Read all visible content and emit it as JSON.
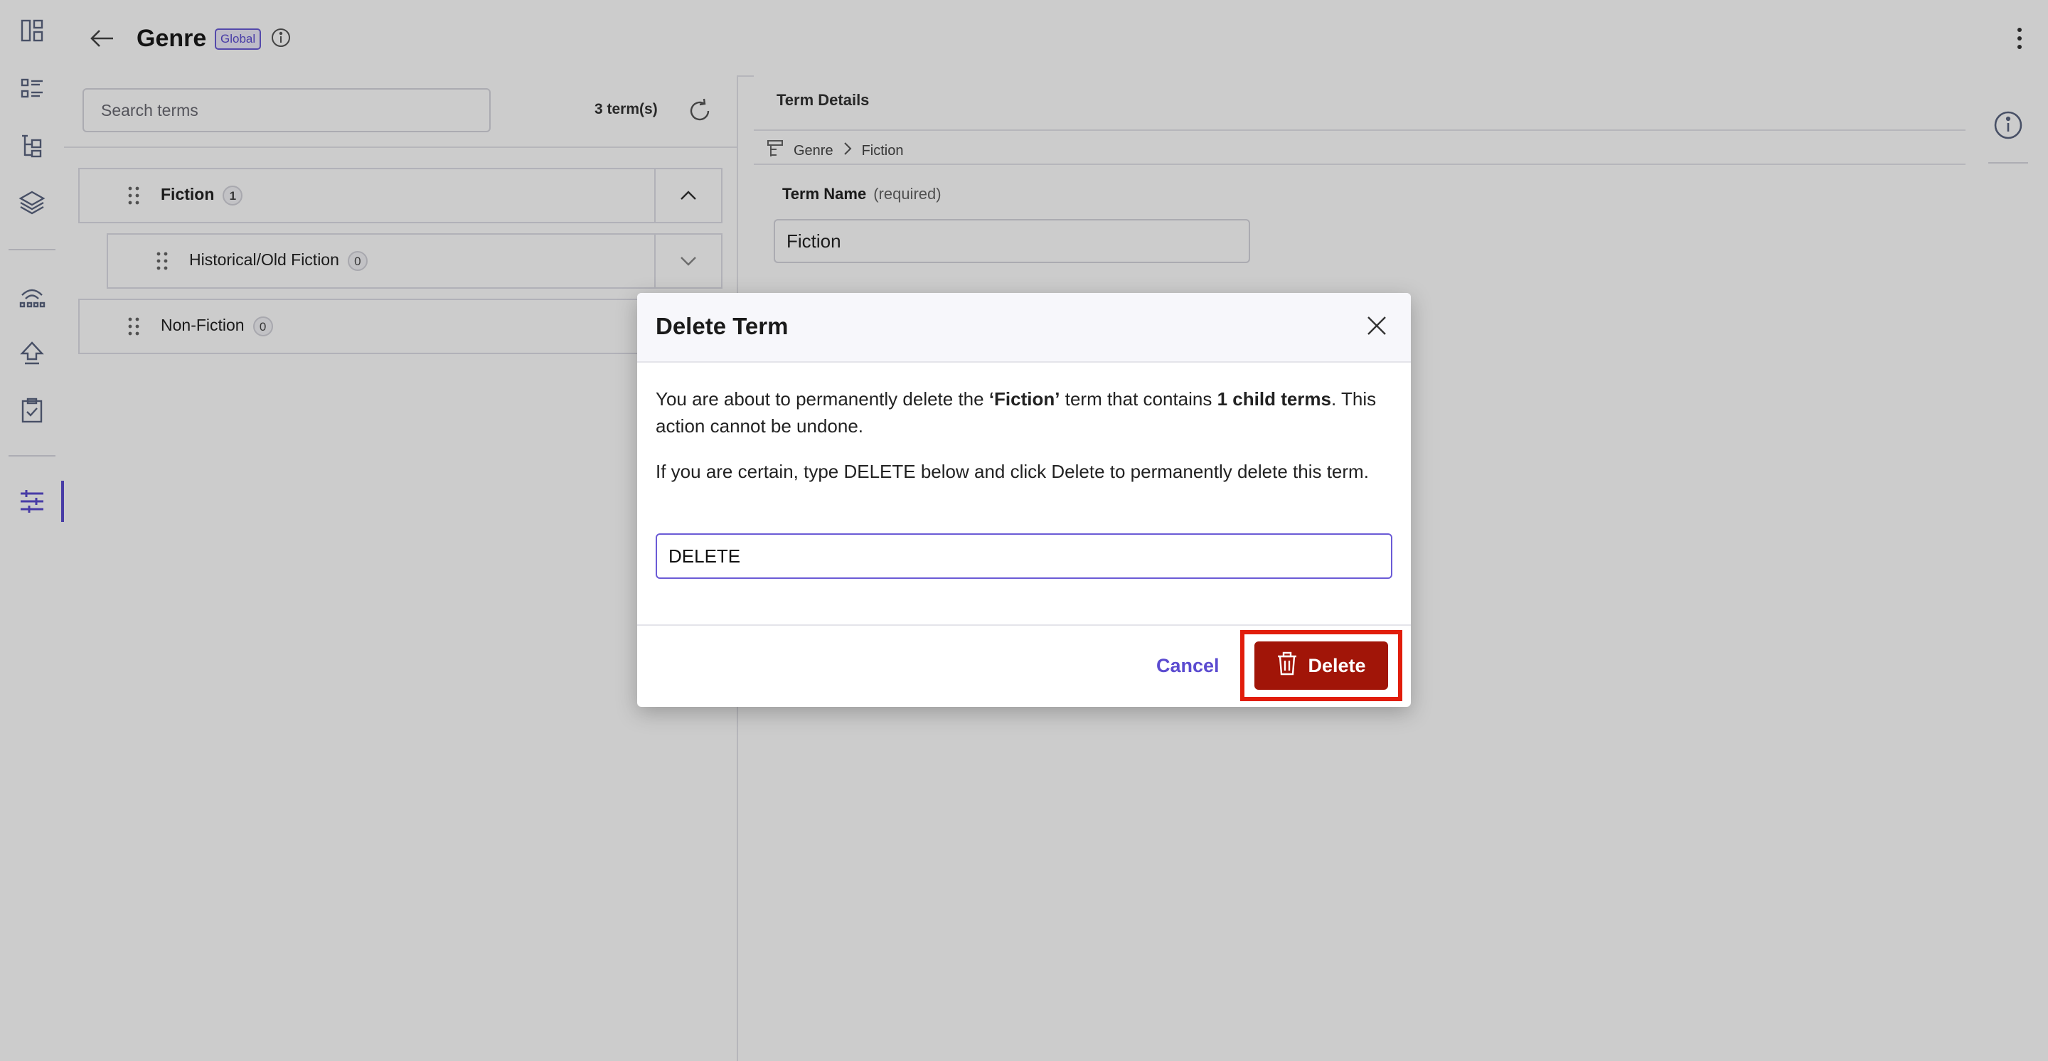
{
  "header": {
    "title": "Genre",
    "badge": "Global"
  },
  "left_panel": {
    "search_placeholder": "Search terms",
    "term_count": "3 term(s)",
    "terms": [
      {
        "label": "Fiction",
        "count": "1"
      },
      {
        "label": "Historical/Old Fiction",
        "count": "0"
      },
      {
        "label": "Non-Fiction",
        "count": "0"
      }
    ]
  },
  "details": {
    "title": "Term Details",
    "breadcrumb": [
      "Genre",
      "Fiction"
    ],
    "field_label": "Term Name",
    "field_hint": "(required)",
    "field_value": "Fiction"
  },
  "modal": {
    "title": "Delete Term",
    "line1_a": "You are about to permanently delete the ",
    "line1_term": "‘Fiction’",
    "line1_b": " term that contains ",
    "line1_child": "1 child terms",
    "line1_c": ". This action cannot be undone.",
    "line2": "If you are certain, type DELETE below and click Delete to permanently delete this term.",
    "input_value": "DELETE",
    "cancel_label": "Cancel",
    "delete_label": "Delete"
  },
  "colors": {
    "accent": "#5b4bd0",
    "danger": "#a11508",
    "highlight": "#e11d0b"
  }
}
